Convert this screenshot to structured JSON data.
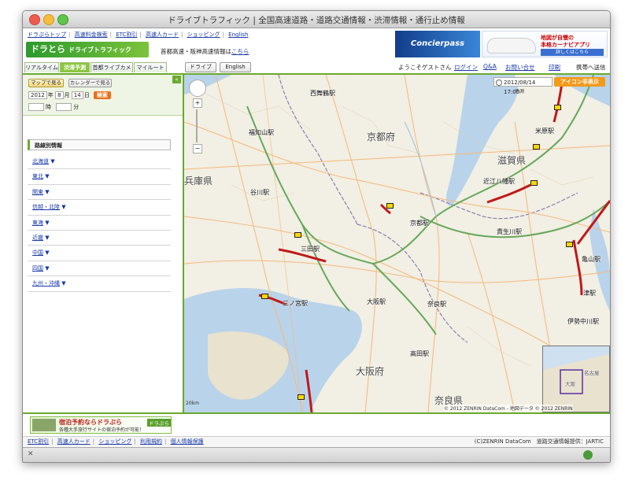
{
  "window": {
    "title": "ドライブトラフィック | 全国高速道路・道路交通情報・渋滞情報・通行止め情報"
  },
  "top_nav": [
    "ドラぷらトップ",
    "高速料金検索",
    "ETC割引",
    "高速人カード",
    "ショッピング",
    "English"
  ],
  "logo": {
    "main": "ドラとら",
    "sub": "ドライブトラフィック"
  },
  "info_line": {
    "text": "首都高速・阪神高速情報は",
    "link": "こちら"
  },
  "banner": {
    "ad1": "Concierpass",
    "ad2_line1": "地図が自慢の",
    "ad2_line2": "本格カーナビアプリ",
    "ad2_button": "詳しくはこちら"
  },
  "tabs": [
    "リアルタイム",
    "渋滞予測",
    "首都ライブカメラ",
    "マイルート"
  ],
  "tab_active": "渋滞予測",
  "mode_buttons": [
    "ドライブ",
    "English"
  ],
  "header_user": {
    "welcome": "ようこそゲストさん",
    "login": "ログイン",
    "qa": "Q&A",
    "contact": "お問い合せ",
    "print": "印刷",
    "mobile": "携帯へ送信"
  },
  "sidebar": {
    "map_button": "マップで見る",
    "calendar_button": "カレンダーで見る",
    "collapse": "«",
    "year": "2012",
    "year_label": "年",
    "month": "8",
    "month_label": "月",
    "day": "14",
    "day_label": "日",
    "go_button": "検索",
    "hour_label": "時",
    "minute_label": "分",
    "route_title": "路線別情報",
    "regions": [
      "北海道",
      "東北",
      "関東",
      "信越・北陸",
      "東海",
      "近畿",
      "中国",
      "四国",
      "九州・沖縄"
    ]
  },
  "map": {
    "datetime": "2012/08/14 17:00",
    "forecast_label": "予測",
    "icon_button": "アイコン非表示",
    "scale": "20km",
    "copyright": "© 2012 ZENRIN DataCom - 地図データ © 2012 ZENRIN",
    "labels": {
      "nishimaizuru": "西舞鶴駅",
      "fukuchiyama": "福知山駅",
      "tanikawa": "谷川駅",
      "hyogo": "兵庫県",
      "kyoto_pref": "京都府",
      "kyoto_st": "京都駅",
      "shiga": "滋賀県",
      "maibara": "米原駅",
      "omihachiman": "近江八幡駅",
      "kibukawa": "貴生川駅",
      "kameyama": "亀山駅",
      "tsu": "津駅",
      "iseokayama": "伊勢中川駅",
      "nara_st": "奈良駅",
      "osaka_st": "大阪駅",
      "sannomiya": "三ノ宮駅",
      "sanda": "三田駅",
      "osaka_pref": "大阪府",
      "takada": "高田駅",
      "nara_pref": "奈良県",
      "nagoya": "名古屋",
      "osaka_ov": "大阪"
    }
  },
  "bottom_ad": {
    "title": "宿泊予約ならドラぷら",
    "sub": "各種大手旅行サイトの宿泊予約が可能！",
    "badge": "ドラぷら"
  },
  "footer": {
    "links": [
      "ETC割引",
      "高速人カード",
      "ショッピング",
      "利用規約",
      "個人情報保護"
    ],
    "right": "(C)ZENRIN DataCom　道路交通情報提供：JARTIC"
  }
}
